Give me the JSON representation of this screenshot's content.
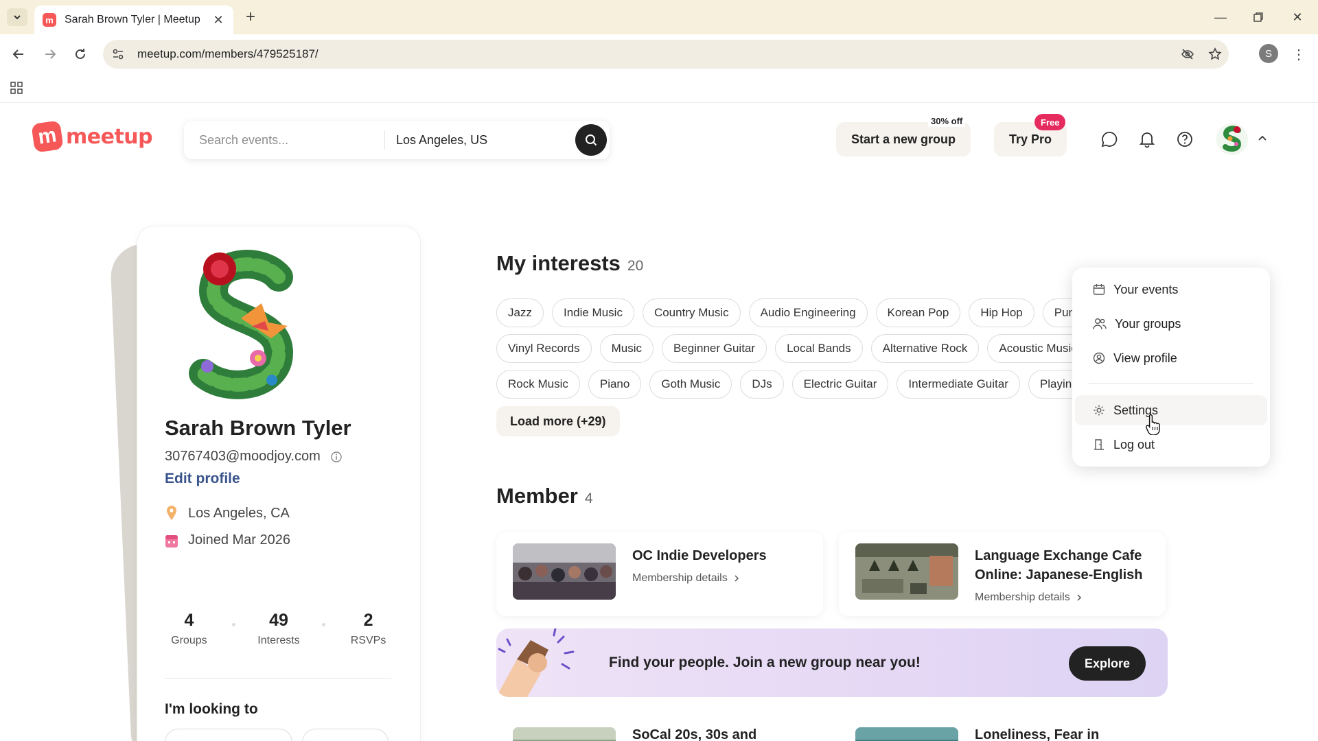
{
  "browser": {
    "tab_title": "Sarah Brown Tyler | Meetup",
    "url": "meetup.com/members/479525187/",
    "profile_initial": "S"
  },
  "header": {
    "logo_text": "meetup",
    "search_placeholder": "Search events...",
    "location_value": "Los Angeles, US",
    "start_group_label": "Start a new group",
    "promo_badge": "30% off",
    "try_pro_label": "Try Pro",
    "free_badge": "Free"
  },
  "dropdown": {
    "items": [
      {
        "label": "Your events",
        "icon": "calendar-icon"
      },
      {
        "label": "Your groups",
        "icon": "people-icon"
      },
      {
        "label": "View profile",
        "icon": "user-circle-icon"
      },
      {
        "label": "Settings",
        "icon": "gear-icon"
      },
      {
        "label": "Log out",
        "icon": "door-icon"
      }
    ]
  },
  "profile": {
    "name": "Sarah Brown Tyler",
    "email": "30767403@moodjoy.com",
    "edit_label": "Edit profile",
    "location": "Los Angeles, CA",
    "joined": "Joined Mar 2026",
    "stats": [
      {
        "value": "4",
        "label": "Groups"
      },
      {
        "value": "49",
        "label": "Interests"
      },
      {
        "value": "2",
        "label": "RSVPs"
      }
    ],
    "looking_title": "I'm looking to"
  },
  "interests": {
    "title": "My interests",
    "count": "20",
    "rows": [
      [
        "Jazz",
        "Indie Music",
        "Country Music",
        "Audio Engineering",
        "Korean Pop",
        "Hip Hop",
        "Punk R"
      ],
      [
        "Vinyl Records",
        "Music",
        "Beginner Guitar",
        "Local Bands",
        "Alternative Rock",
        "Acoustic Music"
      ],
      [
        "Rock Music",
        "Piano",
        "Goth Music",
        "DJs",
        "Electric Guitar",
        "Intermediate Guitar",
        "Playing Music"
      ]
    ],
    "load_more": "Load more (+29)"
  },
  "member": {
    "title": "Member",
    "count": "4",
    "groups": [
      {
        "name": "OC Indie Developers",
        "link": "Membership details"
      },
      {
        "name": "Language Exchange Cafe Online: Japanese-English",
        "link": "Membership details"
      }
    ],
    "banner_text": "Find your people. Join a new group near you!",
    "explore_label": "Explore",
    "more_groups": [
      "SoCal 20s, 30s and",
      "Loneliness, Fear in"
    ]
  }
}
